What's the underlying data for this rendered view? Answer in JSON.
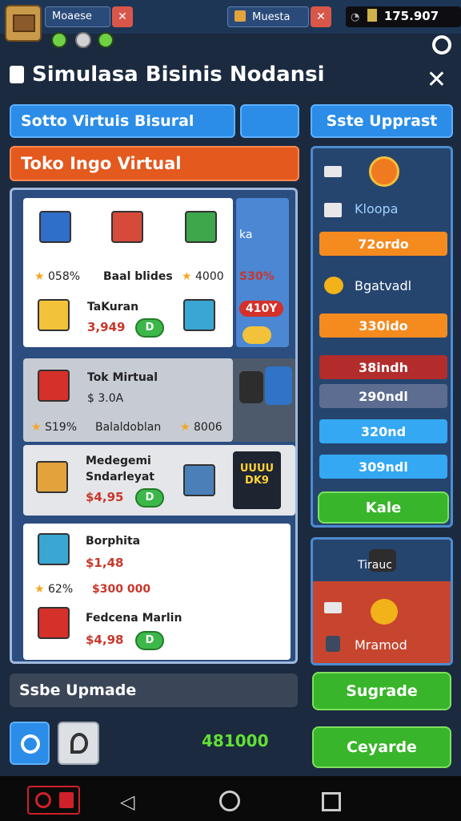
{
  "status": {
    "chip_left": "Moaese",
    "chip_mid": "Muesta",
    "clock": "175.907"
  },
  "title": "Simulasa Bisinis Nodansi",
  "tabs": {
    "tab1": "Sotto Virtuis Bisural",
    "tab_right": "Sste Upprast"
  },
  "shop_header": "Toko Ingo Virtual",
  "cards": {
    "c1": {
      "pct": "058%",
      "name": "Baal blides",
      "amount": "4000",
      "side_pct": "S30%",
      "side_label": "ka"
    },
    "c2": {
      "name": "TaKuran",
      "price": "3,949",
      "badge": "D",
      "red_tag": "410Y"
    },
    "c3": {
      "name": "Tok Mirtual",
      "price": "$ 3.0A",
      "pct": "S19%",
      "label": "Balaldoblan",
      "amount": "8006"
    },
    "c4": {
      "name1": "Medegemi",
      "name2": "Sndarleyat",
      "price": "$4,95",
      "badge": "D",
      "sign": "UUUU DK9"
    },
    "c5": {
      "name": "Borphita",
      "price": "$1,48",
      "pct": "62%",
      "amount": "$300 000"
    },
    "c6": {
      "name": "Fedcena Marlin",
      "price": "$4,98",
      "badge": "D"
    }
  },
  "right_panel": {
    "label1": "Kloopa",
    "bar1": "72ordo",
    "label2": "Bgatvadl",
    "bar2": "330ido",
    "bar3": "38indh",
    "bar4": "290ndl",
    "bar5": "320nd",
    "bar6": "309ndl",
    "btn": "Kale"
  },
  "right_panel2": {
    "label1": "Tirauc",
    "label2": "Mramod"
  },
  "upgrade_bar": "Ssbe Upmade",
  "upgrade_btn": "Sugrade",
  "coins": "481000",
  "bottom_btn": "Ceyarde",
  "colors": {
    "accent_blue": "#2b8de8",
    "accent_orange": "#e3591e",
    "accent_green": "#38b52a",
    "bg": "#1b2a3f"
  }
}
